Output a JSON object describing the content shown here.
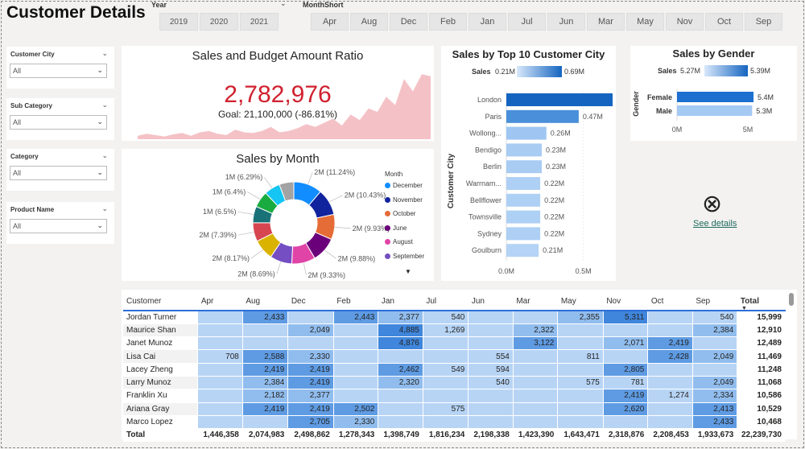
{
  "page": {
    "title": "Customer Details"
  },
  "year_slicer": {
    "label": "Year",
    "options": [
      "2019",
      "2020",
      "2021"
    ]
  },
  "month_slicer": {
    "label": "MonthShort",
    "options": [
      "Apr",
      "Aug",
      "Dec",
      "Feb",
      "Jan",
      "Jul",
      "Jun",
      "Mar",
      "May",
      "Nov",
      "Oct",
      "Sep"
    ]
  },
  "filters": [
    {
      "label": "Customer City",
      "value": "All"
    },
    {
      "label": "Sub Category",
      "value": "All"
    },
    {
      "label": "Category",
      "value": "All"
    },
    {
      "label": "Product Name",
      "value": "All"
    }
  ],
  "kpi": {
    "title": "Sales and Budget Amount Ratio",
    "value": "2,782,976",
    "goal": "Goal: 21,100,000 (-86.81%)",
    "value_color": "#d0202e",
    "area_color": "#f4c2c6"
  },
  "donut": {
    "title": "Sales by Month",
    "legend_title": "Month",
    "legend": [
      {
        "name": "December",
        "color": "#118dff"
      },
      {
        "name": "November",
        "color": "#12239e"
      },
      {
        "name": "October",
        "color": "#e66c37"
      },
      {
        "name": "June",
        "color": "#6b007b"
      },
      {
        "name": "August",
        "color": "#e044a7"
      },
      {
        "name": "September",
        "color": "#744ec2"
      }
    ],
    "more_icon": "▼",
    "labels": [
      "2M (11.24%)",
      "2M (10.43%)",
      "2M (9.93%)",
      "2M (9.88%)",
      "2M (9.33%)",
      "2M (8.69%)",
      "2M (8.17%)",
      "2M (7.39%)",
      "1M (6.5%)",
      "1M (6.4%)",
      "1M (6.29%)"
    ]
  },
  "city_chart": {
    "title": "Sales by Top 10 Customer City",
    "legend_label": "Sales",
    "legend_min": "0.21M",
    "legend_max": "0.69M",
    "ylabel": "Customer City",
    "x_ticks": [
      "0.0M",
      "0.5M"
    ],
    "bars": [
      {
        "city": "London",
        "label": "0.69M"
      },
      {
        "city": "Paris",
        "label": "0.47M"
      },
      {
        "city": "Wollong...",
        "label": "0.26M"
      },
      {
        "city": "Bendigo",
        "label": "0.23M"
      },
      {
        "city": "Berlin",
        "label": "0.23M"
      },
      {
        "city": "Warrnam...",
        "label": "0.22M"
      },
      {
        "city": "Bellflower",
        "label": "0.22M"
      },
      {
        "city": "Townsville",
        "label": "0.22M"
      },
      {
        "city": "Sydney",
        "label": "0.22M"
      },
      {
        "city": "Goulburn",
        "label": "0.21M"
      }
    ]
  },
  "gender_chart": {
    "title": "Sales by Gender",
    "legend_label": "Sales",
    "legend_min": "5.27M",
    "legend_max": "5.39M",
    "ylabel": "Gender",
    "x_ticks": [
      "0M",
      "5M"
    ],
    "bars": [
      {
        "name": "Female",
        "label": "5.4M"
      },
      {
        "name": "Male",
        "label": "5.3M"
      }
    ]
  },
  "see_details": {
    "label": "See details",
    "icon": "⊗"
  },
  "matrix": {
    "headers": [
      "Customer",
      "Apr",
      "Aug",
      "Dec",
      "Feb",
      "Jan",
      "Jul",
      "Jun",
      "Mar",
      "May",
      "Nov",
      "Oct",
      "Sep",
      "Total"
    ],
    "rows": [
      [
        "Jordan Turner",
        "",
        "2,433",
        "",
        "2,443",
        "2,377",
        "540",
        "",
        "",
        "2,355",
        "5,311",
        "",
        "540",
        "15,999"
      ],
      [
        "Maurice Shan",
        "",
        "",
        "2,049",
        "",
        "4,885",
        "1,269",
        "",
        "2,322",
        "",
        "",
        "",
        "2,384",
        "12,910"
      ],
      [
        "Janet Munoz",
        "",
        "",
        "",
        "",
        "4,876",
        "",
        "",
        "3,122",
        "",
        "2,071",
        "2,419",
        "",
        "12,489"
      ],
      [
        "Lisa Cai",
        "708",
        "2,588",
        "2,330",
        "",
        "",
        "",
        "554",
        "",
        "811",
        "",
        "2,428",
        "2,049",
        "11,469"
      ],
      [
        "Lacey Zheng",
        "",
        "2,419",
        "2,419",
        "",
        "2,462",
        "549",
        "594",
        "",
        "",
        "2,805",
        "",
        "",
        "11,248"
      ],
      [
        "Larry Munoz",
        "",
        "2,384",
        "2,419",
        "",
        "2,320",
        "",
        "540",
        "",
        "575",
        "781",
        "",
        "2,049",
        "11,068"
      ],
      [
        "Franklin Xu",
        "",
        "2,182",
        "2,377",
        "",
        "",
        "",
        "",
        "",
        "",
        "2,419",
        "1,274",
        "2,334",
        "10,586"
      ],
      [
        "Ariana Gray",
        "",
        "2,419",
        "2,419",
        "2,502",
        "",
        "575",
        "",
        "",
        "",
        "2,620",
        "",
        "2,413",
        "10,529"
      ],
      [
        "Marco Lopez",
        "",
        "",
        "2,705",
        "2,330",
        "",
        "",
        "",
        "",
        "",
        "",
        "",
        "2,433",
        "10,468"
      ]
    ],
    "total_row": [
      "Total",
      "1,446,358",
      "2,074,983",
      "2,498,862",
      "1,278,343",
      "1,398,749",
      "1,816,234",
      "2,198,338",
      "1,423,390",
      "1,643,471",
      "2,318,876",
      "2,208,453",
      "1,933,673",
      "22,239,730"
    ]
  }
}
